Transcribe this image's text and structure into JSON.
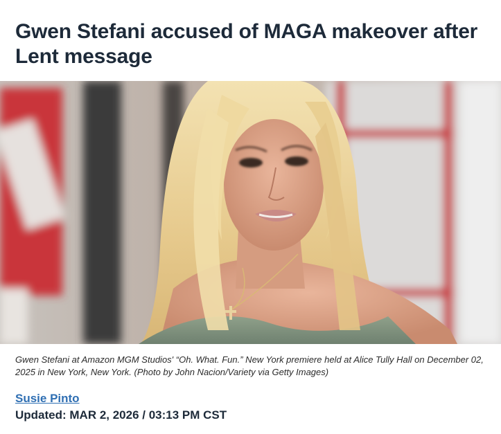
{
  "article": {
    "headline": "Gwen Stefani accused of MAGA makeover after Lent message",
    "caption": "Gwen Stefani at Amazon MGM Studios' “Oh. What. Fun.” New York premiere held at Alice Tully Hall on December 02, 2025 in New York, New York. (Photo by John Nacion/Variety via Getty Images)",
    "author": "Susie Pinto",
    "updated": "Updated: MAR 2, 2026 / 03:13 PM CST"
  },
  "colors": {
    "headline": "#1d2a39",
    "author_link": "#2f6fb3",
    "backdrop_red": "#c9353a",
    "hair": "#e8cf95"
  }
}
